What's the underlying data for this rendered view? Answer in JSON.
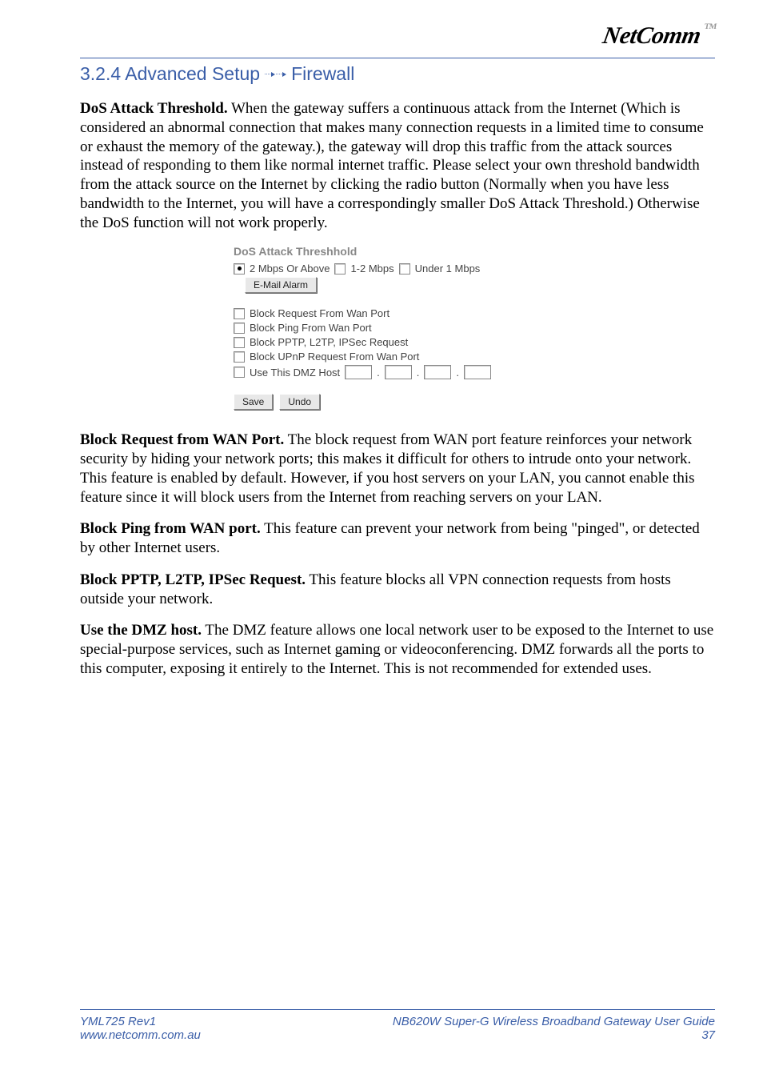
{
  "logo": {
    "text": "NetComm",
    "tm": "TM"
  },
  "heading": {
    "prefix": "3.2.4 Advanced Setup",
    "suffix": "Firewall"
  },
  "paras": {
    "p1": {
      "bold": "DoS Attack Threshold.",
      "text": " When the gateway suffers a continuous attack from the Internet (Which is considered an abnormal connection that makes many connection requests in a limited time to consume or exhaust the memory of the gateway.), the gateway will drop this traffic from the attack sources instead of responding to them like normal internet traffic. Please select your own threshold bandwidth from the attack source on the Internet by clicking the radio button (Normally when you have less bandwidth to the Internet, you will have a correspondingly smaller DoS Attack Threshold.) Otherwise the DoS function will not work properly."
    },
    "p2": {
      "bold": "Block Request from WAN Port.",
      "text": " The block request from WAN port feature reinforces your network security by hiding your network ports; this makes it difficult for others to intrude onto your network. This feature is enabled by default. However, if you host servers on your LAN, you cannot enable this feature since it will block users from the Internet from reaching servers on your LAN."
    },
    "p3": {
      "bold": "Block Ping from WAN port.",
      "text": " This feature can prevent your network from being \"pinged\", or detected by other Internet users."
    },
    "p4": {
      "bold": "Block PPTP, L2TP, IPSec Request.",
      "text": " This feature blocks all VPN connection requests from hosts outside your network."
    },
    "p5": {
      "bold": "Use the DMZ host.",
      "text": " The DMZ feature allows one local network user to be exposed to the Internet to use special-purpose services, such as Internet gaming or videoconferencing. DMZ forwards all the ports to this computer, exposing it entirely to the Internet. This is not recommended for extended uses."
    }
  },
  "screenshot": {
    "title": "DoS Attack Threshhold",
    "radios": {
      "r1": {
        "label": "2 Mbps Or Above",
        "selected": true
      },
      "r2": {
        "label": "1-2 Mbps",
        "selected": false
      },
      "r3": {
        "label": "Under 1 Mbps",
        "selected": false
      }
    },
    "email_alarm_btn": "E-Mail Alarm",
    "checks": {
      "c1": "Block Request From Wan Port",
      "c2": "Block Ping From Wan Port",
      "c3": "Block PPTP, L2TP, IPSec Request",
      "c4": "Block UPnP Request From Wan Port",
      "c5": "Use This DMZ Host"
    },
    "save_btn": "Save",
    "undo_btn": "Undo"
  },
  "footer": {
    "doc_id": "YML725 Rev1",
    "url": "www.netcomm.com.au",
    "title": "NB620W Super-G Wireless Broadband  Gateway User Guide",
    "page": "37"
  }
}
